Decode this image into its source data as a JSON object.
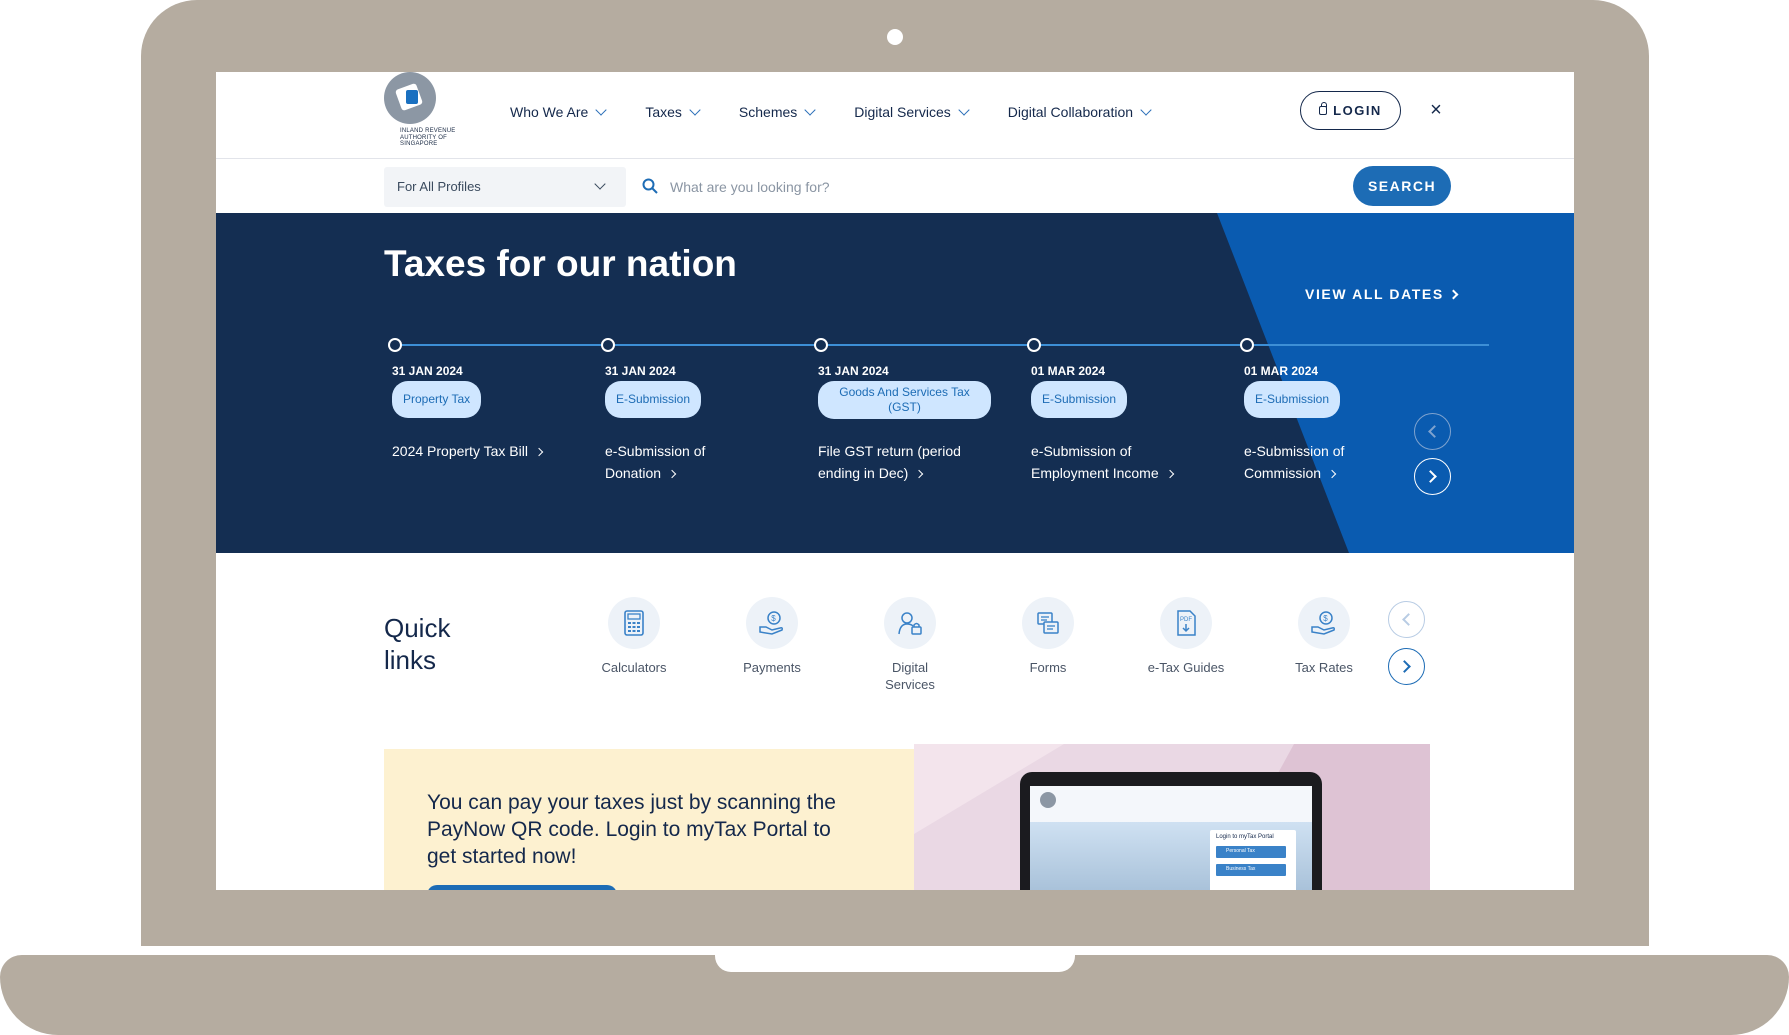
{
  "header": {
    "logo_text": "Inland Revenue Authority of Singapore",
    "nav": [
      {
        "label": "Who We Are"
      },
      {
        "label": "Taxes"
      },
      {
        "label": "Schemes"
      },
      {
        "label": "Digital Services"
      },
      {
        "label": "Digital Collaboration"
      }
    ],
    "login_label": "LOGIN",
    "close_glyph": "×"
  },
  "search": {
    "profile_value": "For All Profiles",
    "placeholder": "What are you looking for?",
    "button_label": "SEARCH"
  },
  "hero": {
    "title": "Taxes for our nation",
    "view_all_label": "VIEW ALL DATES",
    "events": [
      {
        "date": "31 JAN 2024",
        "tag": "Property Tax",
        "text": "2024 Property Tax Bill"
      },
      {
        "date": "31 JAN 2024",
        "tag": "E-Submission",
        "text": "e-Submission of Donation"
      },
      {
        "date": "31 JAN 2024",
        "tag": "Goods And Services Tax (GST)",
        "text": "File GST return (period ending in Dec)"
      },
      {
        "date": "01 MAR 2024",
        "tag": "E-Submission",
        "text": "e-Submission of Employment Income"
      },
      {
        "date": "01 MAR 2024",
        "tag": "E-Submission",
        "text": "e-Submission of Commission"
      }
    ]
  },
  "quick_links": {
    "title": "Quick links",
    "items": [
      {
        "label": "Calculators",
        "icon": "calculator-icon"
      },
      {
        "label": "Payments",
        "icon": "payment-icon"
      },
      {
        "label": "Digital Services",
        "icon": "digital-services-icon"
      },
      {
        "label": "Forms",
        "icon": "forms-icon"
      },
      {
        "label": "e-Tax Guides",
        "icon": "pdf-guide-icon"
      },
      {
        "label": "Tax Rates",
        "icon": "tax-rates-icon"
      }
    ]
  },
  "promo": {
    "text": "You can pay your taxes just by scanning the PayNow QR code. Login to myTax Portal to get started now!",
    "tablet_caption": "Login to myTax Portal",
    "tablet_items": [
      "Personal Tax",
      "Business Tax"
    ]
  },
  "colors": {
    "navy": "#142e52",
    "brand_blue": "#1d6cb5",
    "light_blue": "#cfe6ff",
    "laptop_frame": "#b5aca0",
    "promo_cream": "#fdf1d0"
  }
}
